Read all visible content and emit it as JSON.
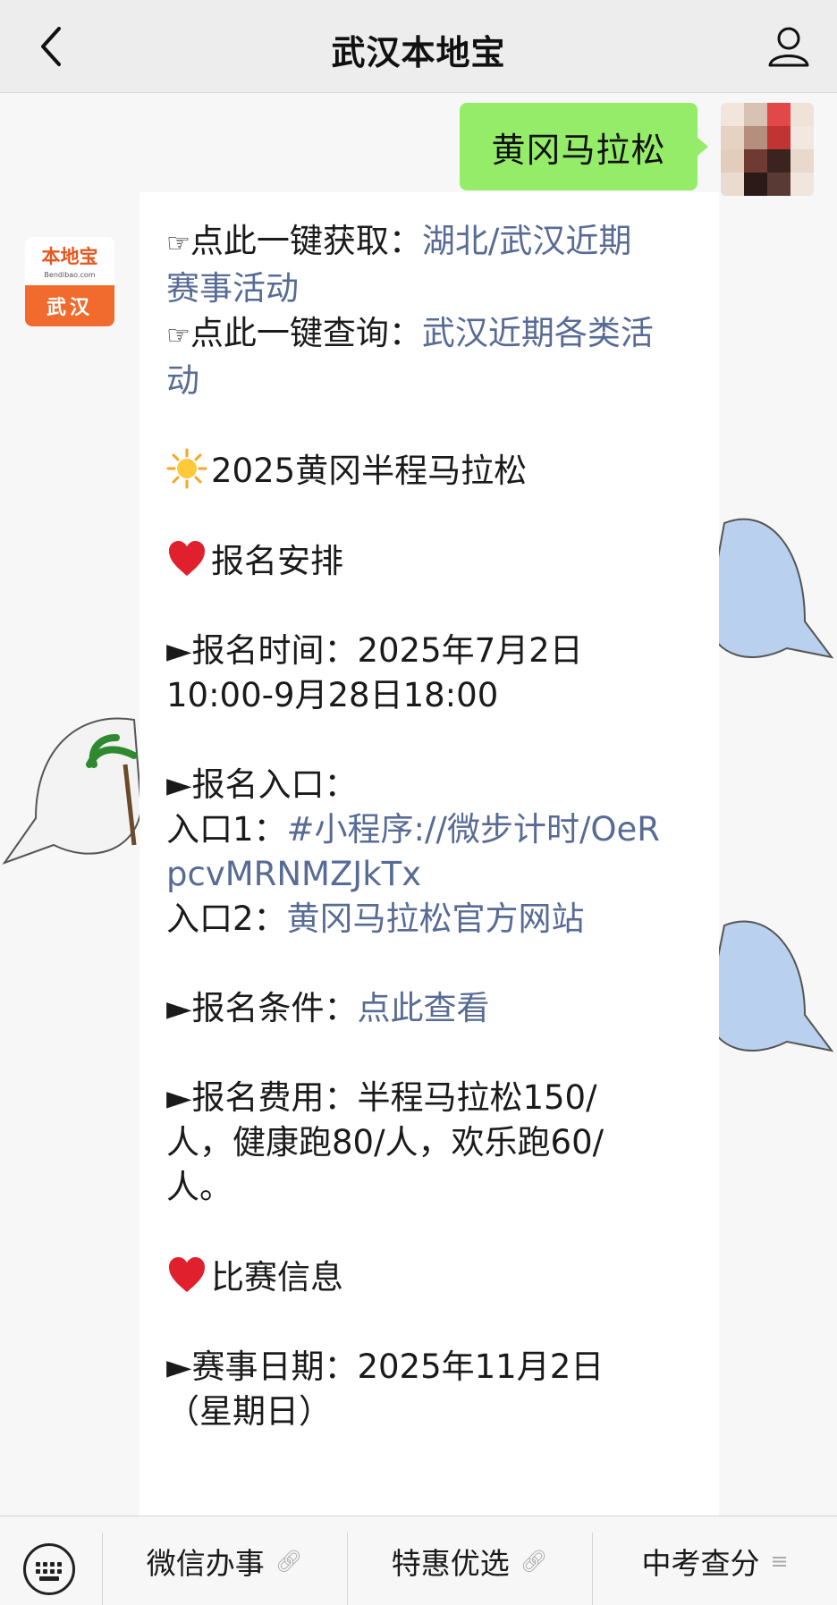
{
  "header": {
    "title": "武汉本地宝",
    "back_icon": "chevron-left-icon",
    "profile_icon": "person-icon"
  },
  "outgoing": {
    "text": "黄冈马拉松"
  },
  "bot": {
    "logo_top": "本地宝",
    "logo_mid": "Bendibao.com",
    "logo_bottom": "武汉"
  },
  "message": {
    "l1_pointer": "☞",
    "l1_prefix": "点此一键获取：",
    "l1_link_a": "湖北/武汉近期",
    "l1_link_b": "赛事活动",
    "l2_pointer": "☞",
    "l2_prefix": "点此一键查询：",
    "l2_link_a": "武汉近期各类活",
    "l2_link_b": "动",
    "event_title": "2025黄冈半程马拉松",
    "section1": "报名安排",
    "reg_time_a": "►报名时间：2025年7月2日",
    "reg_time_b": "10:00-9月28日18:00",
    "entry_label": "►报名入口：",
    "entry1_prefix": "入口1：",
    "entry1_link_a": "#小程序://微步计时/OeR",
    "entry1_link_b": "pcvMRNMZJkTx",
    "entry2_prefix": "入口2：",
    "entry2_link": "黄冈马拉松官方网站",
    "cond_prefix": "►报名条件：",
    "cond_link": "点此查看",
    "fee_a": "►报名费用：半程马拉松150/",
    "fee_b": "人，健康跑80/人，欢乐跑60/",
    "fee_c": "人。",
    "section2": "比赛信息",
    "date_a": "►赛事日期：2025年11月2日",
    "date_b": "（星期日）"
  },
  "menu": {
    "keyboard_icon": "keyboard-icon",
    "item1": "微信办事",
    "item1_icon": "link-icon",
    "item2": "特惠优选",
    "item2_icon": "link-icon",
    "item3": "中考查分",
    "item3_icon": "menu-lines-icon"
  },
  "colors": {
    "link": "#576b95",
    "bubble": "#95ec69",
    "logo_orange": "#f06b2d"
  }
}
